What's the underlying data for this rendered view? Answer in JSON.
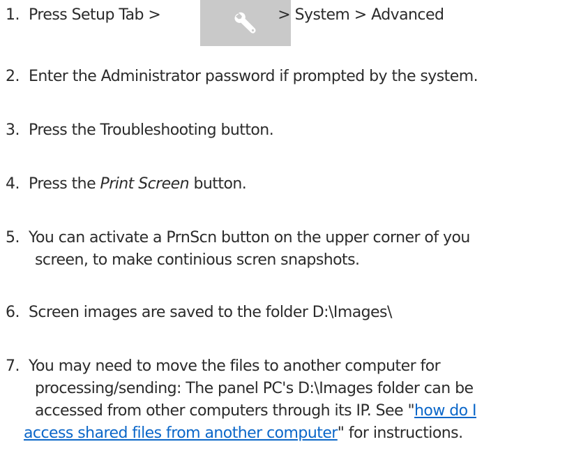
{
  "steps": [
    {
      "num": "1.",
      "before": "Press Setup Tab >",
      "icon": "wrench-icon",
      "after": "> System > Advanced"
    },
    {
      "num": "2.",
      "text": "Enter the Administrator password if prompted by the system."
    },
    {
      "num": "3.",
      "text": "Press the Troubleshooting button."
    },
    {
      "num": "4.",
      "before": "Press the",
      "italic": "Print Screen",
      "after": "button."
    },
    {
      "num": "5.",
      "line1": "You can activate a PrnScn button on the upper corner of you",
      "line2": "screen, to make continious scren snapshots."
    },
    {
      "num": "6.",
      "text": "Screen images are saved to the folder D:\\Images\\"
    },
    {
      "num": "7.",
      "line1": "You may need to move the files to another computer for",
      "line2": "processing/sending: The panel PC's D:\\Images folder can be",
      "line3": "accessed from other computers through its IP. See \"",
      "link_line1": "how do I",
      "link_line2": "access shared files from another computer",
      "after_link": "\" for instructions."
    }
  ]
}
